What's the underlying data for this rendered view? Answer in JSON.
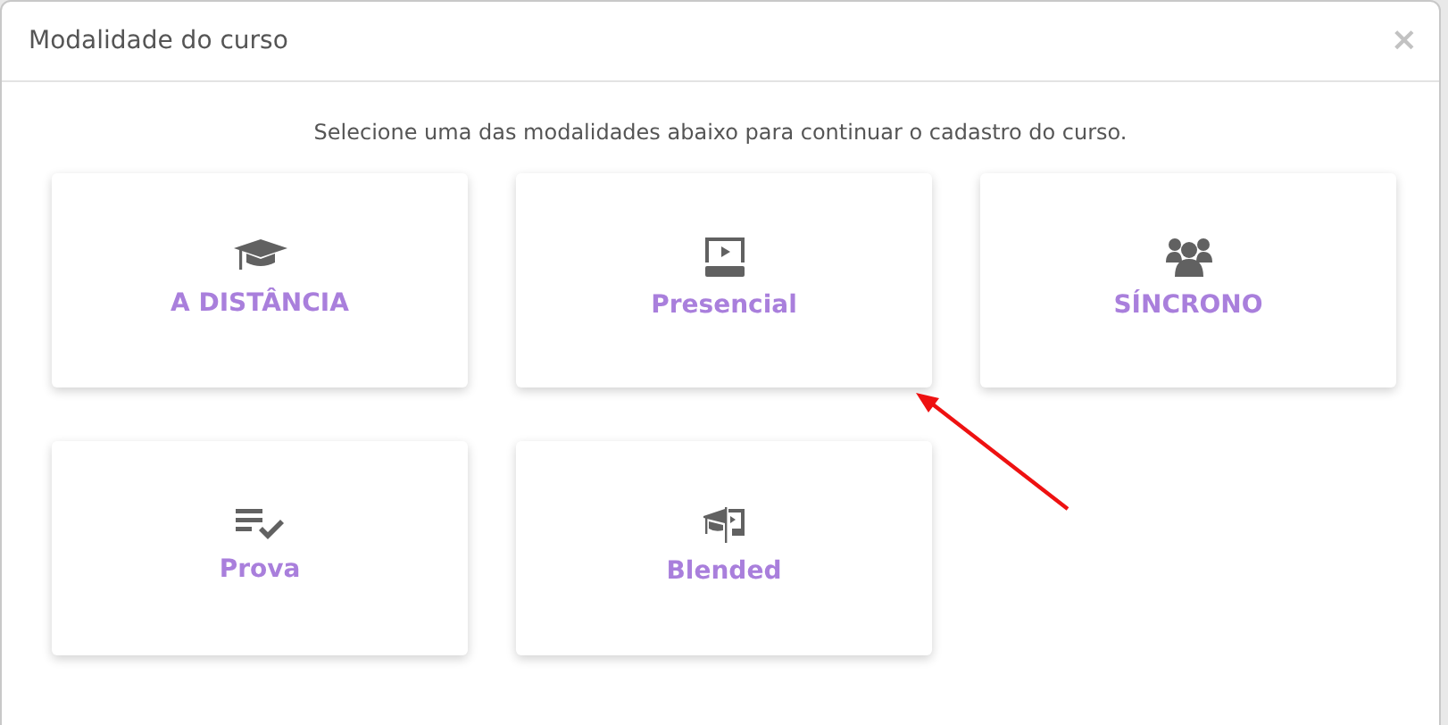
{
  "modal": {
    "title": "Modalidade do curso",
    "close": "×",
    "instruction": "Selecione uma das modalidades abaixo para continuar o cadastro do curso.",
    "options": [
      {
        "label": "A DISTÂNCIA",
        "kind": "cap"
      },
      {
        "label": "Presencial",
        "kind": "screen"
      },
      {
        "label": "SÍNCRONO",
        "kind": "group"
      },
      {
        "label": "Prova",
        "kind": "checklist"
      },
      {
        "label": "Blended",
        "kind": "blended"
      }
    ]
  },
  "annotation": {
    "kind": "arrow"
  }
}
